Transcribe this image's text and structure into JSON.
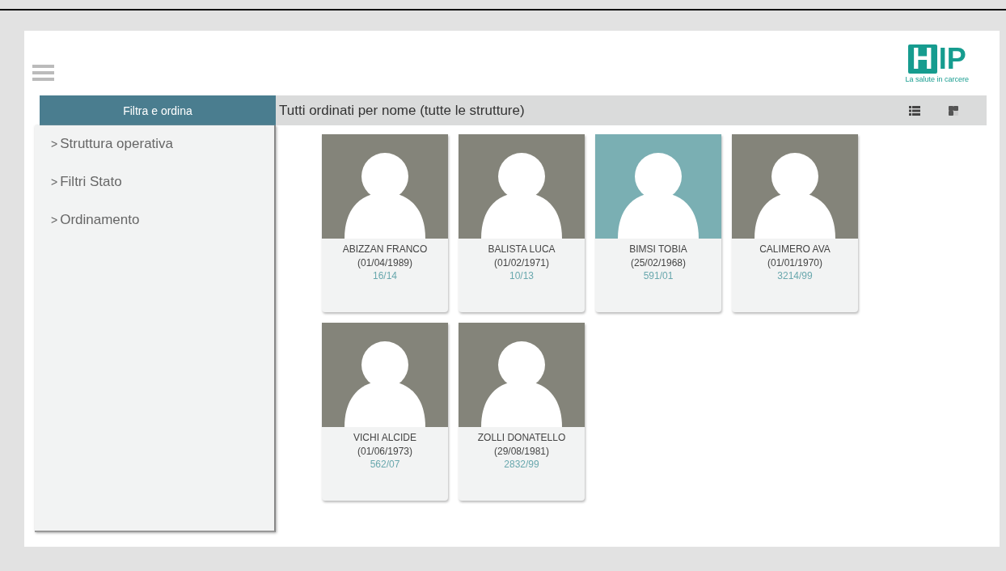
{
  "logo": {
    "letter": "H",
    "rest": "IP",
    "tagline": "La salute in carcere"
  },
  "sidebar": {
    "title": "Filtra e ordina",
    "items": [
      {
        "arrow": ">",
        "label": "Struttura operativa",
        "expanded": false
      },
      {
        "arrow": ">",
        "label": "Filtri Stato",
        "expanded": false
      },
      {
        "arrow": ">",
        "label": "Ordinamento",
        "expanded": false
      }
    ]
  },
  "header": {
    "title": "Tutti ordinati per nome (tutte le strutture)"
  },
  "patients": [
    {
      "name": "ABIZZAN FRANCO",
      "birth": "(01/04/1989)",
      "code": "16/14",
      "selected": false
    },
    {
      "name": "BALISTA LUCA",
      "birth": "(01/02/1971)",
      "code": "10/13",
      "selected": false
    },
    {
      "name": "BIMSI TOBIA",
      "birth": "(25/02/1968)",
      "code": "591/01",
      "selected": true
    },
    {
      "name": "CALIMERO AVA",
      "birth": "(01/01/1970)",
      "code": "3214/99",
      "selected": false
    },
    {
      "name": "VICHI ALCIDE",
      "birth": "(01/06/1973)",
      "code": "562/07",
      "selected": false
    },
    {
      "name": "ZOLLI DONATELLO",
      "birth": "(29/08/1981)",
      "code": "2832/99",
      "selected": false
    }
  ]
}
